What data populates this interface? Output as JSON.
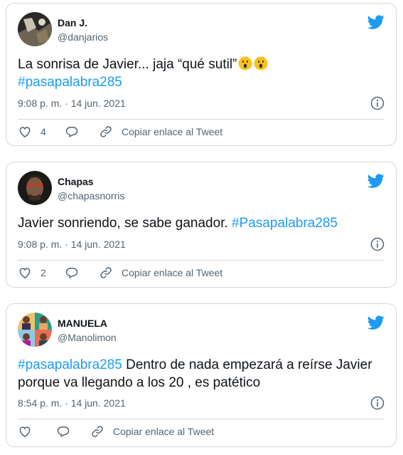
{
  "tweets": [
    {
      "name": "Dan J.",
      "handle": "@danjarios",
      "text_before": "La sonrisa de Javier... jaja “qué sutil”",
      "hashtag": "#pasapalabra285",
      "text_after": "",
      "emoji": [
        "hushed-face-emoji",
        "hushed-face-emoji"
      ],
      "time": "9:08 p. m. · 14 jun. 2021",
      "likes": "4",
      "copy_link": "Copiar enlace al Tweet"
    },
    {
      "name": "Chapas",
      "handle": "@chapasnorris",
      "text_before": "Javier sonriendo, se sabe ganador.",
      "hashtag": "#Pasapalabra285",
      "text_after": "",
      "time": "9:08 p. m. · 14 jun. 2021",
      "likes": "2",
      "copy_link": "Copiar enlace al Tweet"
    },
    {
      "name": "MANUELA",
      "handle": "@Manolimon",
      "text_before": "",
      "hashtag": "#pasapalabra285",
      "text_after_line1": "Dentro de nada empezará a reírse Javier",
      "text_after_line2": "porque va llegando a los 20 , es patético",
      "time": "8:54 p. m. · 14 jun. 2021",
      "likes": "",
      "copy_link": "Copiar enlace al Tweet"
    }
  ],
  "icons": {
    "brand": "twitter-bird-icon",
    "info": "info-icon",
    "like": "heart-icon",
    "reply": "reply-bubble-icon",
    "link": "link-icon"
  },
  "colors": {
    "accent": "#1d9bf0",
    "text": "#0f1419",
    "secondary": "#536471",
    "border": "#cfd9de",
    "emoji": "#fcc21b"
  }
}
